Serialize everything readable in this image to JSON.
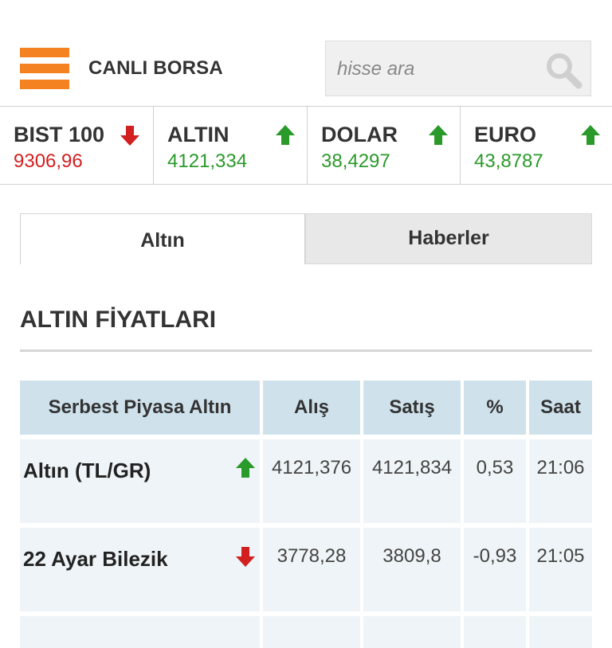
{
  "header": {
    "brand": "CANLI BORSA",
    "search_placeholder": "hisse ara",
    "accent": "#f58220"
  },
  "ticker": [
    {
      "name": "BIST 100",
      "value": "9306,96",
      "direction": "down"
    },
    {
      "name": "ALTIN",
      "value": "4121,334",
      "direction": "up"
    },
    {
      "name": "DOLAR",
      "value": "38,4297",
      "direction": "up"
    },
    {
      "name": "EURO",
      "value": "43,8787",
      "direction": "up"
    }
  ],
  "tabs": [
    {
      "label": "Altın",
      "active": true
    },
    {
      "label": "Haberler",
      "active": false
    }
  ],
  "section_title": "ALTIN FİYATLARI",
  "table": {
    "headers": [
      "Serbest Piyasa Altın",
      "Alış",
      "Satış",
      "%",
      "Saat"
    ],
    "rows": [
      {
        "name": "Altın (TL/GR)",
        "direction": "up",
        "alis": "4121,376",
        "satis": "4121,834",
        "pct": "0,53",
        "saat": "21:06"
      },
      {
        "name": "22 Ayar Bilezik",
        "direction": "down",
        "alis": "3778,28",
        "satis": "3809,8",
        "pct": "-0,93",
        "saat": "21:05"
      }
    ]
  },
  "colors": {
    "up": "#2a9a2a",
    "down": "#d21f1f",
    "table_header": "#cfe2ec",
    "table_row": "#eef4f7"
  }
}
